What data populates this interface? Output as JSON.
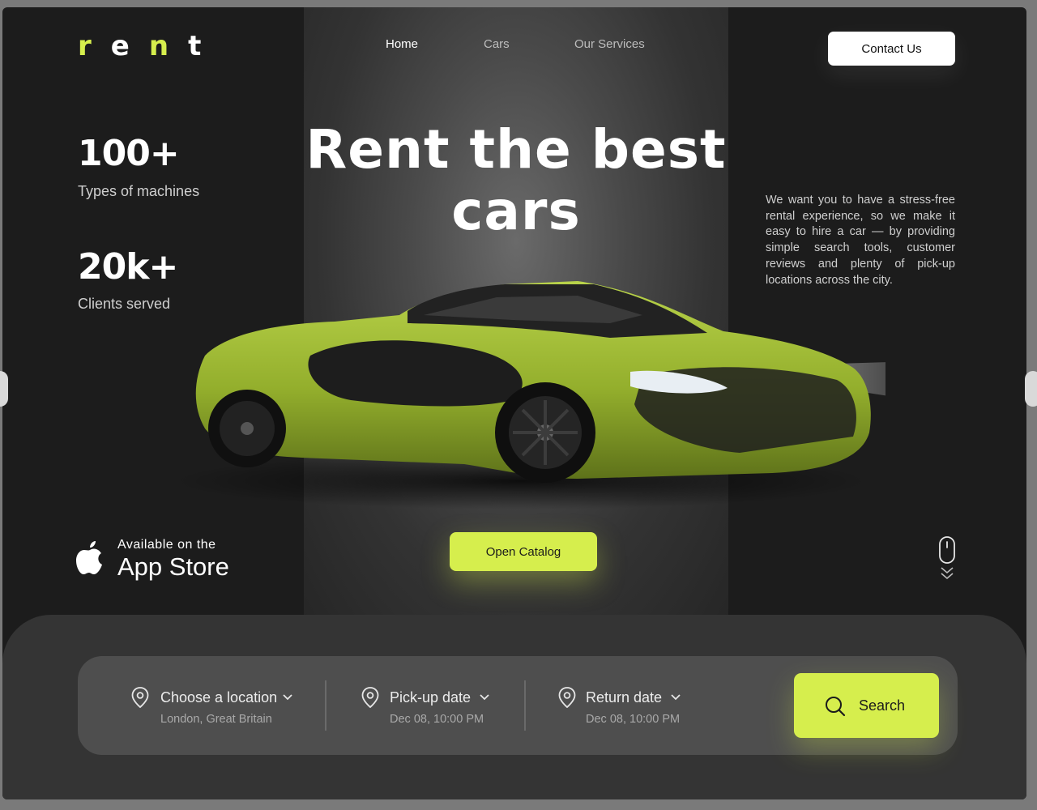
{
  "logo": {
    "r": "r",
    "e": "e",
    "n": "n",
    "t": "t"
  },
  "nav": {
    "home": "Home",
    "cars": "Cars",
    "services": "Our Services"
  },
  "contact_label": "Contact Us",
  "stats": [
    {
      "value": "100+",
      "label": "Types of machines"
    },
    {
      "value": "20k+",
      "label": "Clients served"
    }
  ],
  "hero": {
    "line1": "Rent the best",
    "line2": "cars"
  },
  "description": "We want you to have a stress-free rental experience, so we make it easy to hire a car — by providing simple search tools, customer reviews and plenty of pick-up locations across the city.",
  "appstore": {
    "small": "Available on the",
    "big": "App Store"
  },
  "catalog_label": "Open Catalog",
  "search": {
    "location": {
      "label": "Choose a location",
      "value": "London, Great Britain"
    },
    "pickup": {
      "label": "Pick-up date",
      "value": "Dec 08, 10:00 PM"
    },
    "return": {
      "label": "Return date",
      "value": "Dec 08, 10:00 PM"
    },
    "button": "Search"
  },
  "colors": {
    "accent": "#d6ee4d",
    "background": "#1c1c1c",
    "panel": "#4e4e4e"
  },
  "icons": [
    "apple-icon",
    "map-pin-icon",
    "chevron-down-icon",
    "search-icon",
    "mouse-scroll-icon",
    "car-image"
  ]
}
